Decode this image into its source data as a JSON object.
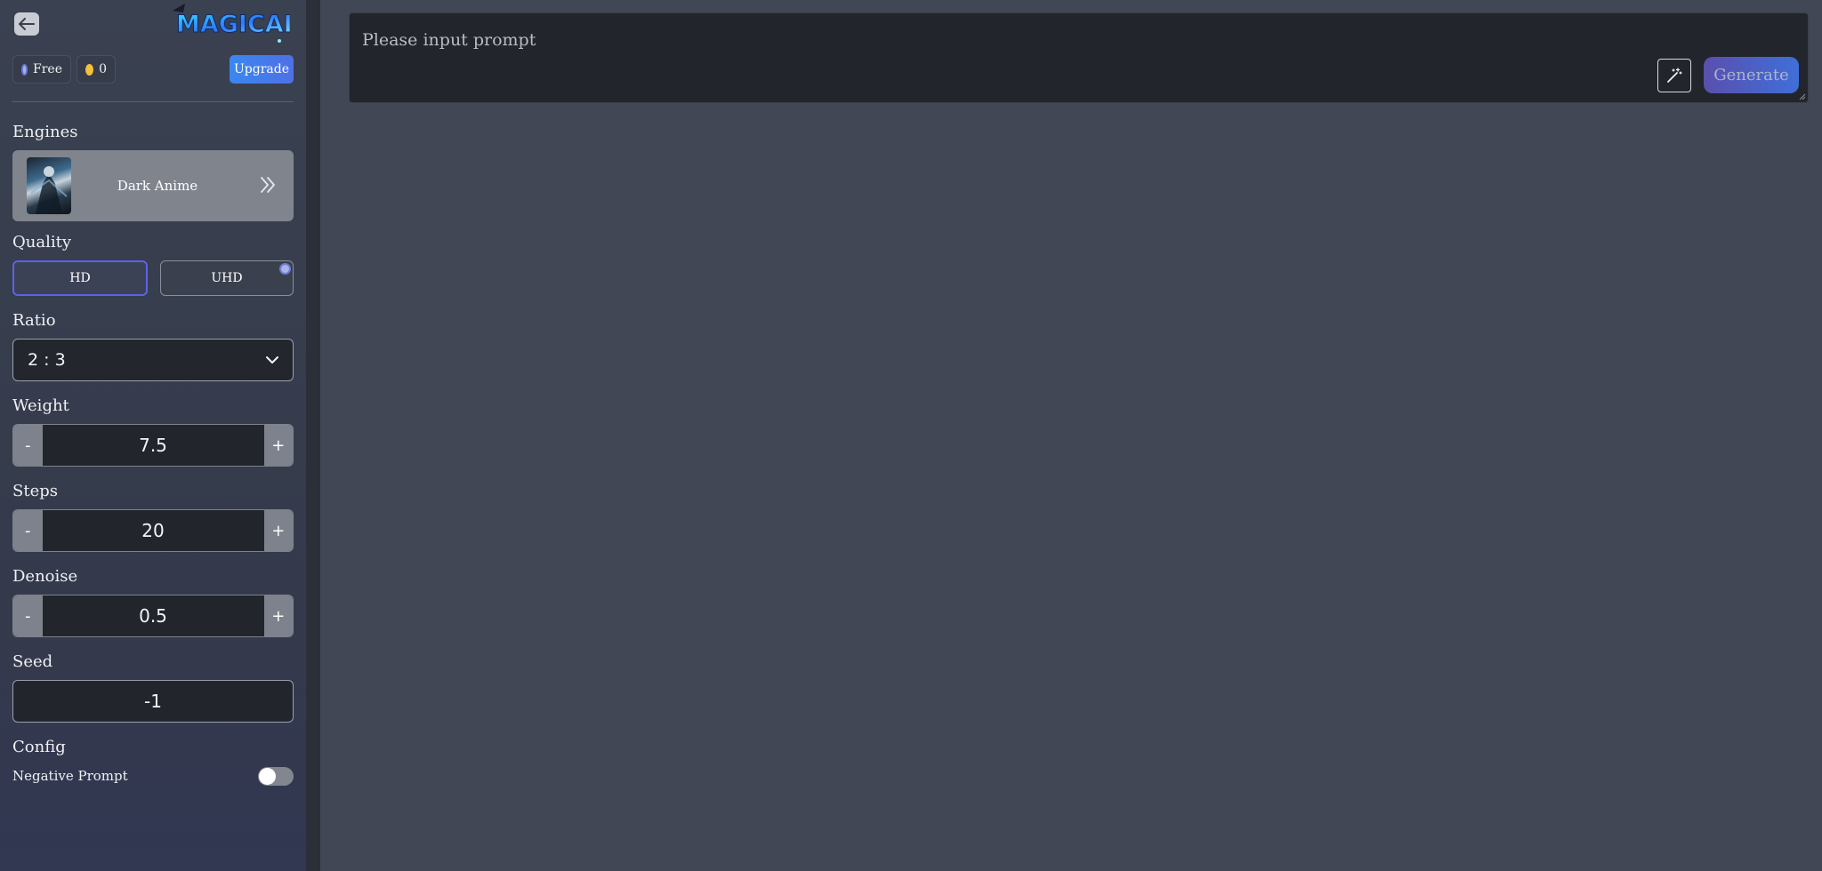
{
  "sidebar": {
    "back_icon": "arrow-left-icon",
    "logo_text": "MAGICAI",
    "plan": {
      "label": "Free",
      "icon": "plan-badge-icon"
    },
    "coins": {
      "count": "0",
      "icon": "coin-icon"
    },
    "upgrade_label": "Upgrade",
    "engines": {
      "label": "Engines",
      "selected_name": "Dark Anime",
      "arrow_icon": "double-chevron-right-icon"
    },
    "quality": {
      "label": "Quality",
      "options": [
        {
          "label": "HD",
          "active": true
        },
        {
          "label": "UHD",
          "active": false,
          "premium": true
        }
      ]
    },
    "ratio": {
      "label": "Ratio",
      "value": "2 : 3"
    },
    "weight": {
      "label": "Weight",
      "value": "7.5",
      "minus": "-",
      "plus": "+"
    },
    "steps": {
      "label": "Steps",
      "value": "20",
      "minus": "-",
      "plus": "+"
    },
    "denoise": {
      "label": "Denoise",
      "value": "0.5",
      "minus": "-",
      "plus": "+"
    },
    "seed": {
      "label": "Seed",
      "value": "-1"
    },
    "config": {
      "label": "Config",
      "negative_prompt_label": "Negative Prompt",
      "negative_prompt_enabled": false
    }
  },
  "main": {
    "prompt_placeholder": "Please input prompt",
    "magic_icon": "magic-wand-icon",
    "generate_label": "Generate"
  },
  "colors": {
    "accent": "#5b63e8",
    "upgrade": "#3a87f0",
    "coin": "#f3c13a",
    "background": "#414754",
    "sidebar": "#3a4150"
  }
}
